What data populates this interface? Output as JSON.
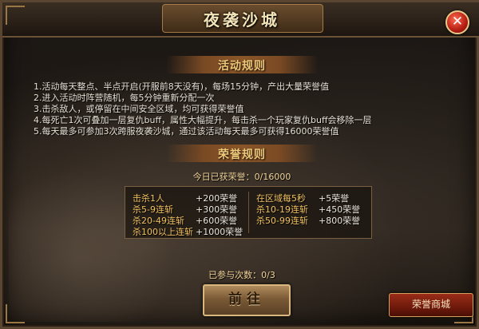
{
  "window": {
    "title": "夜袭沙城"
  },
  "activity_rules": {
    "heading": "活动规则",
    "lines": [
      "1.活动每天整点、半点开启(开服前8天没有)，每场15分钟，产出大量荣誉值",
      "2.进入活动时阵营随机，每5分钟重新分配一次",
      "3.击杀敌人，或停留在中间安全区域，均可获得荣誉值",
      "4.每死亡1次可叠加一层复仇buff，属性大幅提升，每击杀一个玩家复仇buff会移除一层",
      "5.每天最多可参加3次跨服夜袭沙城，通过该活动每天最多可获得16000荣誉值"
    ]
  },
  "honor_rules": {
    "heading": "荣誉规则",
    "today_label": "今日已获荣誉：0/16000",
    "left": [
      {
        "label": "击杀1人",
        "value": "+200荣誉"
      },
      {
        "label": "杀5-9连斩",
        "value": "+300荣誉"
      },
      {
        "label": "杀20-49连斩",
        "value": "+600荣誉"
      },
      {
        "label": "杀100以上连斩",
        "value": "+1000荣誉"
      }
    ],
    "right": [
      {
        "label": "在区域每5秒",
        "value": "+5荣誉"
      },
      {
        "label": "杀10-19连斩",
        "value": "+450荣誉"
      },
      {
        "label": "杀50-99连斩",
        "value": "+800荣誉"
      }
    ]
  },
  "participation": "已参与次数：0/3",
  "buttons": {
    "go": "前往",
    "shop": "荣誉商城"
  },
  "icons": {
    "close": "close-icon"
  }
}
